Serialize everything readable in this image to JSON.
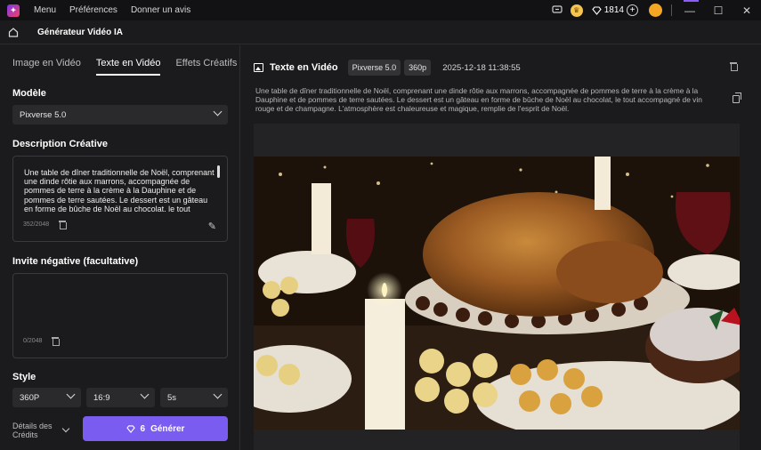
{
  "titlebar": {
    "menu": [
      "Menu",
      "Préférences",
      "Donner un avis"
    ],
    "credits": "1814",
    "window_controls": [
      "minimize-icon",
      "maximize-icon",
      "close-icon"
    ]
  },
  "header": {
    "title": "Générateur Vidéo IA"
  },
  "left": {
    "tabs": [
      {
        "label": "Image en Vidéo",
        "active": false
      },
      {
        "label": "Texte en Vidéo",
        "active": true
      },
      {
        "label": "Effets Créatifs",
        "active": false
      }
    ],
    "model": {
      "label": "Modèle",
      "value": "Pixverse 5.0"
    },
    "description": {
      "label": "Description Créative",
      "text": "Une table de dîner traditionnelle de Noël, comprenant une dinde rôtie aux marrons, accompagnée de pommes de terre à la crème à la Dauphine et de pommes de terre sautées. Le dessert est un gâteau en forme de bûche de Noël au chocolat, le tout",
      "counter": "352/2048"
    },
    "negative": {
      "label": "Invite négative (facultative)",
      "counter": "0/2048"
    },
    "style": {
      "label": "Style"
    },
    "resolution": "360P",
    "ratio": "16:9",
    "duration": "5s",
    "details_label": "Détails des Crédits",
    "generate": {
      "cost": "6",
      "label": "Générer"
    }
  },
  "right": {
    "title": "Texte en Vidéo",
    "model_chip": "Pixverse 5.0",
    "res_chip": "360p",
    "datetime": "2025-12-18 11:38:55",
    "prompt": "Une table de dîner traditionnelle de Noël, comprenant une dinde rôtie aux marrons, accompagnée de pommes de terre à la crème à la Dauphine et de pommes de terre sautées. Le dessert est un gâteau en forme de bûche de Noël au chocolat, le tout accompagné de vin rouge et de champagne. L'atmosphère est chaleureuse et magique, remplie de l'esprit de Noël."
  },
  "colors": {
    "accent": "#7a5cf0",
    "background": "#1b1b1d",
    "titlebar": "#121214"
  }
}
